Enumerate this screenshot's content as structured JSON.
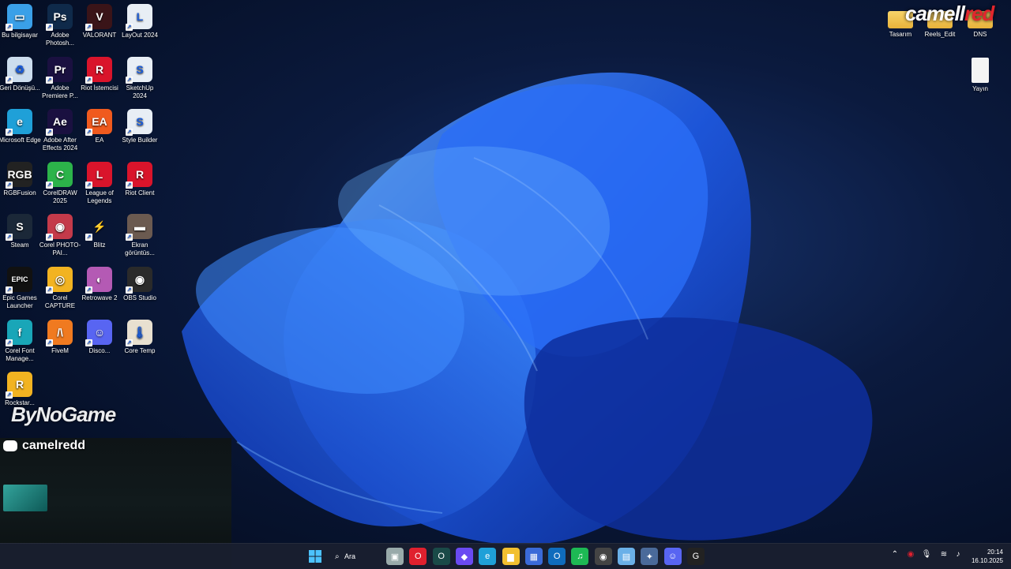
{
  "desktop_icons": [
    {
      "label": "Bu bilgisayar",
      "color": "#3aa0e8",
      "glyph": "▭",
      "icon": "computer-icon"
    },
    {
      "label": "Adobe Photosh...",
      "color": "#0f2a4a",
      "glyph": "Ps",
      "icon": "photoshop-icon"
    },
    {
      "label": "VALORANT",
      "color": "#3a1418",
      "glyph": "V",
      "icon": "valorant-icon"
    },
    {
      "label": "LayOut 2024",
      "color": "#e8eef5",
      "glyph": "L",
      "icon": "layout-icon"
    },
    {
      "label": "Geri Dönüşü...",
      "color": "#cde",
      "glyph": "♻",
      "icon": "recycle-bin-icon"
    },
    {
      "label": "Adobe Premiere P...",
      "color": "#1a1040",
      "glyph": "Pr",
      "icon": "premiere-icon"
    },
    {
      "label": "Riot İstemcisi",
      "color": "#d9142b",
      "glyph": "R",
      "icon": "riot-client-icon"
    },
    {
      "label": "SketchUp 2024",
      "color": "#e8eef5",
      "glyph": "S",
      "icon": "sketchup-icon"
    },
    {
      "label": "Microsoft Edge",
      "color": "#1fa0d8",
      "glyph": "e",
      "icon": "edge-icon"
    },
    {
      "label": "Adobe After Effects 2024",
      "color": "#1a1040",
      "glyph": "Ae",
      "icon": "after-effects-icon"
    },
    {
      "label": "EA",
      "color": "#f05a1e",
      "glyph": "EA",
      "icon": "ea-icon"
    },
    {
      "label": "Style Builder",
      "color": "#e8eef5",
      "glyph": "S",
      "icon": "style-builder-icon"
    },
    {
      "label": "RGBFusion",
      "color": "#222",
      "glyph": "RGB",
      "icon": "rgbfusion-icon"
    },
    {
      "label": "CorelDRAW 2025",
      "color": "#2cb34a",
      "glyph": "C",
      "icon": "coreldraw-icon"
    },
    {
      "label": "League of Legends",
      "color": "#d9142b",
      "glyph": "L",
      "icon": "league-icon"
    },
    {
      "label": "Riot Client",
      "color": "#d9142b",
      "glyph": "R",
      "icon": "riot-client-2-icon"
    },
    {
      "label": "Steam",
      "color": "#1b2838",
      "glyph": "S",
      "icon": "steam-icon"
    },
    {
      "label": "Corel PHOTO-PAI...",
      "color": "#c43a4a",
      "glyph": "◉",
      "icon": "corel-photopaint-icon"
    },
    {
      "label": "Blitz",
      "color": "transparent",
      "glyph": "⚡",
      "icon": "blitz-icon"
    },
    {
      "label": "Ekran görüntüs...",
      "color": "#6b5a50",
      "glyph": "▬",
      "icon": "screenshot-file-icon"
    },
    {
      "label": "Epic Games Launcher",
      "color": "#111",
      "glyph": "EPIC",
      "icon": "epic-games-icon"
    },
    {
      "label": "Corel CAPTURE",
      "color": "#f2b321",
      "glyph": "◎",
      "icon": "corel-capture-icon"
    },
    {
      "label": "Retrowave 2",
      "color": "#b45ab4",
      "glyph": "◐",
      "icon": "retrowave-icon"
    },
    {
      "label": "OBS Studio",
      "color": "#2a2a2a",
      "glyph": "◉",
      "icon": "obs-icon"
    },
    {
      "label": "Corel Font Manage...",
      "color": "#19a6b8",
      "glyph": "f",
      "icon": "corel-font-manager-icon"
    },
    {
      "label": "FiveM",
      "color": "#f07a20",
      "glyph": "/\\",
      "icon": "fivem-icon"
    },
    {
      "label": "Disco...",
      "color": "#5865f2",
      "glyph": "☺",
      "icon": "discord-icon"
    },
    {
      "label": "Core Temp",
      "color": "#e8e0d0",
      "glyph": "🌡",
      "icon": "core-temp-icon"
    },
    {
      "label": "Rockstar...",
      "color": "#f2b321",
      "glyph": "R",
      "icon": "rockstar-icon"
    }
  ],
  "right_icons": [
    {
      "label": "Tasarım",
      "icon": "folder-icon"
    },
    {
      "label": "Reels_Edit",
      "icon": "folder-icon"
    },
    {
      "label": "DNS",
      "icon": "folder-icon"
    },
    {
      "label": "Yayın",
      "icon": "text-file-icon"
    }
  ],
  "overlay": {
    "discord_handle": "camelredd",
    "sponsor": "ByNoGame",
    "brand_white": "camell",
    "brand_red": "red"
  },
  "taskbar": {
    "search_label": "Ara",
    "time": "20:14",
    "date": "16.10.2025",
    "pinned": [
      {
        "name": "task-view-icon",
        "glyph": "▣",
        "color": "#9aa"
      },
      {
        "name": "opera-icon",
        "glyph": "O",
        "color": "#e0202e"
      },
      {
        "name": "opera-gx-icon",
        "glyph": "O",
        "color": "#1a4a48"
      },
      {
        "name": "copilot-icon",
        "glyph": "◆",
        "color": "#6a4af2"
      },
      {
        "name": "edge-taskbar-icon",
        "glyph": "e",
        "color": "#1fa0d8"
      },
      {
        "name": "file-explorer-icon",
        "glyph": "▆",
        "color": "#f2c030"
      },
      {
        "name": "store-icon",
        "glyph": "▦",
        "color": "#3a6ad8"
      },
      {
        "name": "outlook-icon",
        "glyph": "O",
        "color": "#0f6cbd"
      },
      {
        "name": "spotify-icon",
        "glyph": "♫",
        "color": "#1db954"
      },
      {
        "name": "obs-taskbar-icon",
        "glyph": "◉",
        "color": "#444"
      },
      {
        "name": "notepad-icon",
        "glyph": "▤",
        "color": "#6ab0e8"
      },
      {
        "name": "app-icon",
        "glyph": "✦",
        "color": "#4a6a9a"
      },
      {
        "name": "discord-taskbar-icon",
        "glyph": "☺",
        "color": "#5865f2"
      },
      {
        "name": "g-hub-icon",
        "glyph": "G",
        "color": "#222"
      }
    ]
  }
}
